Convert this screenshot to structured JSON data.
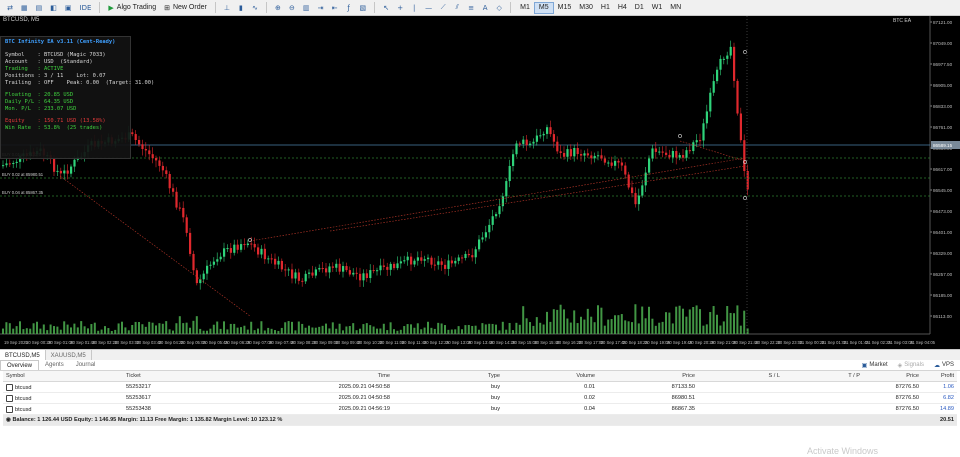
{
  "toolbar": {
    "algo_trading": "Algo Trading",
    "new_order": "New Order",
    "ide": "IDE",
    "timeframes": [
      "M1",
      "M5",
      "M15",
      "M30",
      "H1",
      "H4",
      "D1",
      "W1",
      "MN"
    ],
    "active_timeframe": "M5"
  },
  "chart": {
    "header_symbol": "BTCUSD, M5",
    "corner_label": "BTC EA",
    "line_labels": {
      "buy1": "BUY 0.01 at 87133.5",
      "buy2": "BUY 0.02 at 85980.51",
      "buy3": "BUY 0.04 at 85867.35"
    },
    "price_labels": [
      "87121.00",
      "87049.00",
      "86977.50",
      "86905.00",
      "86833.00",
      "86761.00",
      "86689.00",
      "86617.00",
      "86545.00",
      "86473.00",
      "86401.00",
      "86329.00",
      "86257.00",
      "86185.00",
      "86113.00"
    ],
    "price_marker": "86589.15",
    "time_labels": [
      "19 Sep 2025",
      "20 Sep 00:25",
      "20 Sep 01:05",
      "20 Sep 01:45",
      "20 Sep 02:25",
      "20 Sep 03:05",
      "20 Sep 03:45",
      "20 Sep 04:25",
      "20 Sep 05:05",
      "20 Sep 05:45",
      "20 Sep 06:25",
      "20 Sep 07:05",
      "20 Sep 07:45",
      "20 Sep 08:25",
      "20 Sep 09:05",
      "20 Sep 09:45",
      "20 Sep 10:25",
      "20 Sep 11:05",
      "20 Sep 11:45",
      "20 Sep 12:25",
      "20 Sep 13:05",
      "20 Sep 13:45",
      "20 Sep 14:25",
      "20 Sep 15:05",
      "20 Sep 15:45",
      "20 Sep 16:25",
      "20 Sep 17:05",
      "20 Sep 17:45",
      "20 Sep 18:25",
      "20 Sep 19:05",
      "20 Sep 19:45",
      "20 Sep 20:25",
      "20 Sep 21:05",
      "20 Sep 21:45",
      "20 Sep 22:25",
      "20 Sep 23:05",
      "21 Sep 00:25",
      "21 Sep 01:05",
      "21 Sep 01:45",
      "21 Sep 02:25",
      "21 Sep 03:05",
      "21 Sep 04:05"
    ]
  },
  "ea_panel": {
    "title": "BTC Infinity EA  v3.11 (Cent-Ready)",
    "symbol": "Symbol    : BTCUSD (Magic 7033)",
    "account": "Account   : USD  (Standard)",
    "trading": "Trading   : ACTIVE",
    "positions": "Positions : 3 / 11    Lot: 0.07",
    "trailing": "Trailing  : OFF    Peak: 0.00  (Target: 31.00)",
    "floating": "Floating  : 20.85 USD",
    "daily_pnl": "Daily P/L : 64.35 USD",
    "mon_pnl": "Mon. P/L  : 233.07 USD",
    "equity": "Equity    : 150.71 USD (13.58%)",
    "winrate": "Win Rate  : 53.8%  (25 trades)"
  },
  "chart_tabs": [
    "BTCUSD,M5",
    "XAUUSD,M5"
  ],
  "toolbox": {
    "tabs": [
      "Overview",
      "Agents",
      "Journal"
    ],
    "right": {
      "market": "Market",
      "signals": "Signals",
      "vps": "VPS"
    },
    "columns": [
      "Symbol",
      "Ticket",
      "Time",
      "Type",
      "Volume",
      "Price",
      "S / L",
      "T / P",
      "Price",
      "Profit"
    ],
    "rows": [
      {
        "symbol": "btcusd",
        "ticket": "55253217",
        "time": "2025.09.21 04:50:58",
        "type": "buy",
        "volume": "0.01",
        "price": "87133.50",
        "sl": "",
        "tp": "",
        "cur": "87276.50",
        "profit": "1.06"
      },
      {
        "symbol": "btcusd",
        "ticket": "55253617",
        "time": "2025.09.21 04:50:58",
        "type": "buy",
        "volume": "0.02",
        "price": "86980.51",
        "sl": "",
        "tp": "",
        "cur": "87276.50",
        "profit": "6.82"
      },
      {
        "symbol": "btcusd",
        "ticket": "55253438",
        "time": "2025.09.21 04:56:19",
        "type": "buy",
        "volume": "0.04",
        "price": "86867.35",
        "sl": "",
        "tp": "",
        "cur": "87276.50",
        "profit": "14.89"
      }
    ],
    "summary": "Balance: 1 126.44 USD  Equity: 1 146.95  Margin: 11.13  Free Margin: 1 135.82  Margin Level: 10 123.12 %",
    "summary_profit": "20.51"
  },
  "watermark": "Activate Windows",
  "colors": {
    "bull": "#2fd37a",
    "bear": "#e0282d",
    "grid": "#1b2a3a",
    "accent": "#3fa0ff",
    "volume": "#4caf50"
  }
}
